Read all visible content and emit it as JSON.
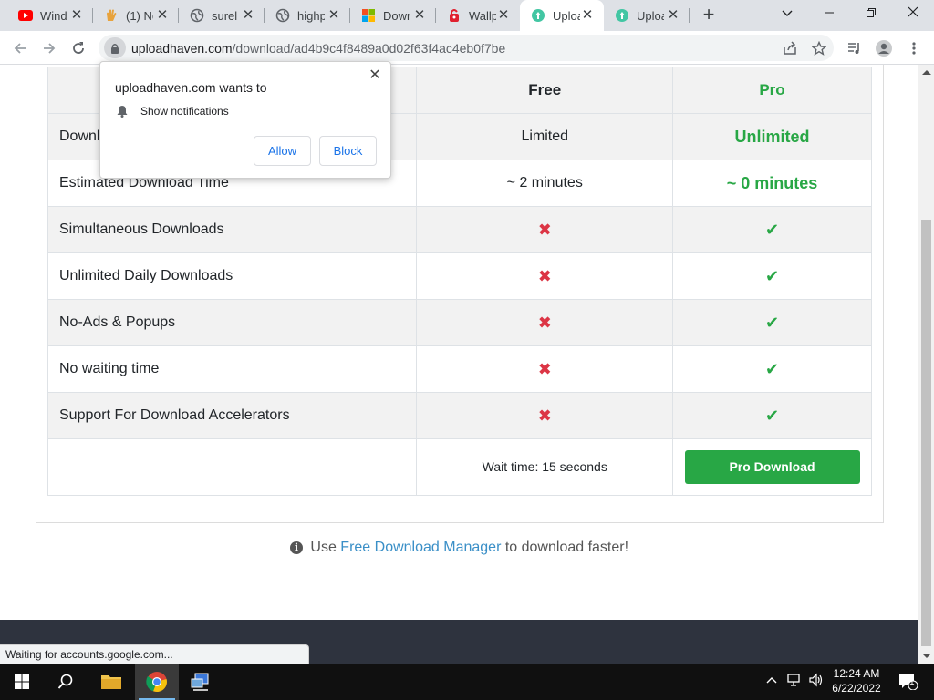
{
  "browser": {
    "tabs": [
      {
        "label": "Wind",
        "icon": "youtube-icon"
      },
      {
        "label": "(1) Ne",
        "icon": "hand-icon"
      },
      {
        "label": "surel",
        "icon": "globe-icon"
      },
      {
        "label": "highp",
        "icon": "globe-icon"
      },
      {
        "label": "Dowr",
        "icon": "windows-store-icon"
      },
      {
        "label": "Wallp",
        "icon": "wallpaper-icon"
      },
      {
        "label": "Uploa",
        "icon": "uploadhaven-icon",
        "active": true
      },
      {
        "label": "Uploa",
        "icon": "uploadhaven-icon"
      }
    ],
    "url_host": "uploadhaven.com",
    "url_path": "/download/ad4b9c4f8489a0d02f63f4ac4eb0f7be"
  },
  "popup": {
    "title": "uploadhaven.com wants to",
    "permission": "Show notifications",
    "allow_label": "Allow",
    "block_label": "Block"
  },
  "table": {
    "headers": {
      "free": "Free",
      "pro": "Pro"
    },
    "rows": [
      {
        "feature": "Download Speed",
        "feature_visible": "Downl",
        "free": "Limited",
        "pro": "Unlimited"
      },
      {
        "feature": "Estimated Download Time",
        "free": "~ 2 minutes",
        "pro": "~ 0 minutes"
      },
      {
        "feature": "Simultaneous Downloads",
        "free": "cross-icon",
        "pro": "check-icon"
      },
      {
        "feature": "Unlimited Daily Downloads",
        "free": "cross-icon",
        "pro": "check-icon"
      },
      {
        "feature": "No-Ads & Popups",
        "free": "cross-icon",
        "pro": "check-icon"
      },
      {
        "feature": "No waiting time",
        "free": "cross-icon",
        "pro": "check-icon"
      },
      {
        "feature": "Support For Download Accelerators",
        "free": "cross-icon",
        "pro": "check-icon"
      }
    ],
    "wait_text": "Wait time: 15 seconds",
    "pro_button": "Pro Download"
  },
  "tip": {
    "prefix": "Use",
    "link": "Free Download Manager",
    "suffix": "to download faster!"
  },
  "status_bar": "Waiting for accounts.google.com...",
  "taskbar": {
    "time": "12:24 AM",
    "date": "6/22/2022",
    "notification_count": "1"
  },
  "colors": {
    "pro_green": "#28a745",
    "cross_red": "#dc3545",
    "link_blue": "#3a8fc7",
    "footer": "#2e333e"
  }
}
